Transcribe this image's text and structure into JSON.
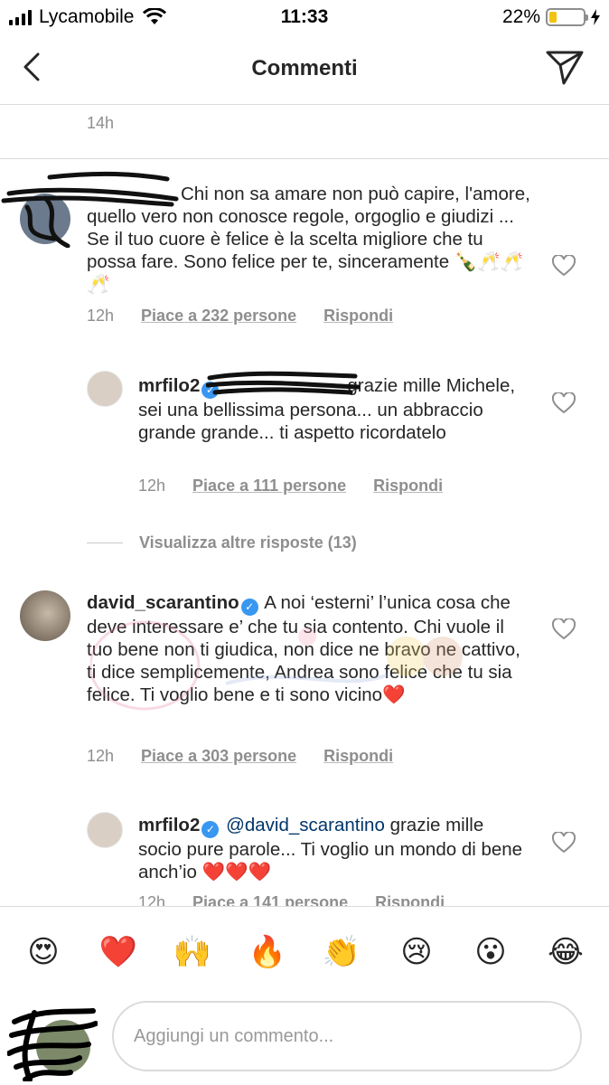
{
  "status": {
    "carrier": "Lycamobile",
    "time": "11:33",
    "battery_percent": "22%",
    "battery_level": 0.22
  },
  "nav": {
    "title": "Commenti",
    "back_icon": "chevron-left-icon",
    "send_icon": "paper-plane-icon"
  },
  "previous": {
    "time": "14h"
  },
  "comments": [
    {
      "text": "Chi non sa amare non può capire, l'amore, quello vero non conosce regole, orgoglio e giudizi ... Se il tuo cuore è felice è la scelta migliore che tu possa fare. Sono felice per te, sinceramente 🍾🥂🥂🥂",
      "time": "12h",
      "likes": "Piace a 232 persone",
      "reply": "Rispondi"
    },
    {
      "username": "mrfilo2",
      "text": "grazie mille Michele, sei una bellissima persona... un abbraccio grande grande... ti aspetto ricordatelo",
      "time": "12h",
      "likes": "Piace a 111 persone",
      "reply": "Rispondi"
    },
    {
      "view_more": "Visualizza altre risposte (13)"
    },
    {
      "username": "david_scarantino",
      "text": "A noi ‘esterni’ l’unica cosa che deve interessare e’ che tu sia contento. Chi vuole il tuo bene non ti giudica, non dice ne bravo ne cattivo, ti dice semplicemente, Andrea sono felice che tu sia felice. Ti voglio bene e ti sono vicino❤️",
      "time": "12h",
      "likes": "Piace a 303 persone",
      "reply": "Rispondi"
    },
    {
      "username": "mrfilo2",
      "mention": "@david_scarantino",
      "text": "grazie mille socio pure parole... Ti voglio un mondo di bene anch’io ❤️❤️❤️",
      "time": "12h",
      "likes": "Piace a 141 persone",
      "reply": "Rispondi"
    }
  ],
  "emojis": [
    "😍",
    "❤️",
    "🙌",
    "🔥",
    "👏",
    "😢",
    "😮",
    "😂"
  ],
  "composer": {
    "placeholder": "Aggiungi un commento..."
  },
  "colors": {
    "text": "#262626",
    "secondary": "#8e8e8e",
    "verified": "#3897f0",
    "divider": "#dbdbdb"
  }
}
